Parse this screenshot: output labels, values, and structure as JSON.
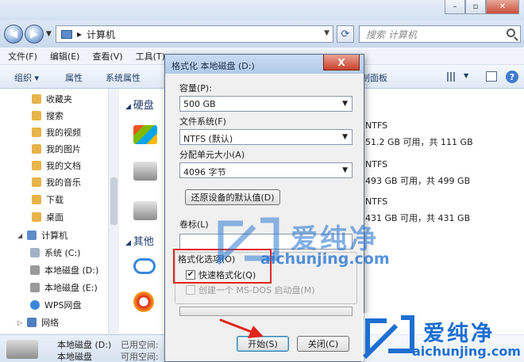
{
  "explorer": {
    "address": "计算机",
    "search_placeholder": "搜索 计算机",
    "menu": [
      "文件(F)",
      "编辑(E)",
      "查看(V)",
      "工具(T)"
    ],
    "commands": {
      "organize": "组织 ▾",
      "properties": "属性",
      "system_properties": "系统属性",
      "map_drive": "制面板"
    },
    "nav_items": [
      "收藏夹",
      "搜索",
      "我的视频",
      "我的图片",
      "我的文档",
      "我的音乐",
      "下载",
      "桌面",
      "计算机",
      "系统 (C:)",
      "本地磁盘 (D:)",
      "本地磁盘 (E:)",
      "WPS网盘",
      "网络"
    ],
    "sections": {
      "hdd": "硬盘",
      "other": "其他"
    },
    "drives": [
      {
        "fs": "NTFS",
        "free": "51.2 GB 可用，共 111 GB"
      },
      {
        "fs": "NTFS",
        "free": "493 GB 可用，共 499 GB"
      },
      {
        "fs": "NTFS",
        "free": "431 GB 可用，共 431 GB"
      }
    ],
    "details": {
      "name": "本地磁盘 (D:)",
      "used": "已用空间:",
      "type": "本地磁盘",
      "total": "可用空间:"
    }
  },
  "dialog": {
    "title": "格式化 本地磁盘 (D:)",
    "close_glyph": "X",
    "capacity_label": "容量(P):",
    "capacity_value": "500 GB",
    "fs_label": "文件系统(F)",
    "fs_value": "NTFS (默认)",
    "alloc_label": "分配单元大小(A)",
    "alloc_value": "4096 字节",
    "restore_button": "还原设备的默认值(D)",
    "volume_label": "卷标(L)",
    "volume_value": "",
    "options_legend": "格式化选项(O)",
    "quick_format": "快速格式化(Q)",
    "quick_format_checked": true,
    "mbr_option": "创建一个 MS-DOS 启动盘(M)",
    "start_button": "开始(S)",
    "close_button": "关闭(C)"
  },
  "watermark": {
    "cn": "爱纯净",
    "url": "aichunjing.com"
  },
  "colors": {
    "highlight": "#e0251c",
    "watermark": "#1d6fd0"
  }
}
